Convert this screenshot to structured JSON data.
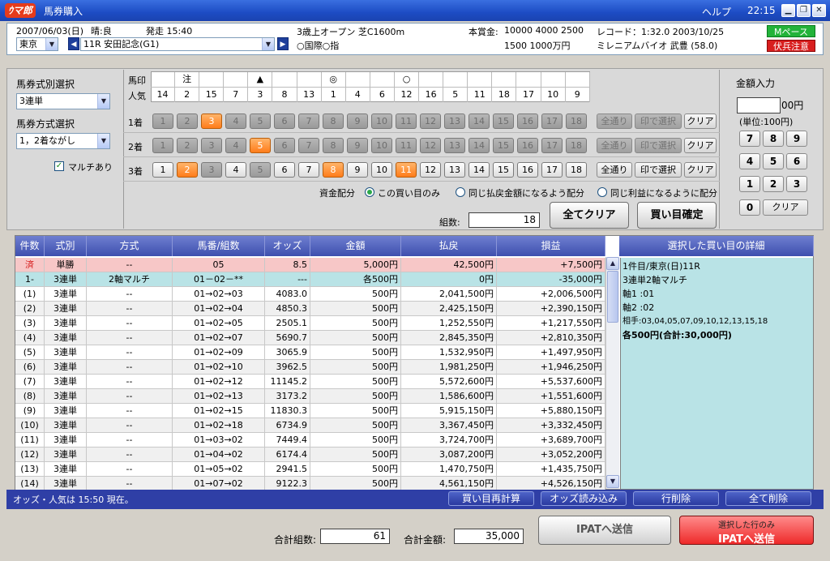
{
  "titlebar": {
    "logo": "ｳマ郎",
    "title": "馬券購入",
    "help": "ヘルプ",
    "clock": "22:15"
  },
  "race": {
    "date": "2007/06/03(日)",
    "track_cond": "晴:良",
    "post_time": "発走 15:40",
    "venue": "東京",
    "race": "11R 安田記念(G1)",
    "cond1": "3歳上オープン 芝C1600m",
    "cond2": "○国際○指",
    "prize_label": "本賞金:",
    "prize1": "10000 4000 2500",
    "prize2": "1500 1000万円",
    "record": "レコード：1:32.0 2003/10/25",
    "record_horse": "ミレニアムバイオ 武豊 (58.0)",
    "pace": "Mペース",
    "warning": "伏兵注意"
  },
  "left": {
    "type_label": "馬券式別選択",
    "type_value": "3連単",
    "method_label": "馬券方式選択",
    "method_value": "1，2着ながし",
    "multi_label": "マルチあり",
    "multi_checked": "✓"
  },
  "marks": {
    "row1_label": "馬印",
    "row2_label": "人気",
    "marks": [
      "",
      "注",
      "",
      "",
      "▲",
      "",
      "",
      "◎",
      "",
      "",
      "○",
      "",
      "",
      "",
      "",
      "",
      "",
      ""
    ],
    "popularity": [
      "14",
      "2",
      "15",
      "7",
      "3",
      "8",
      "13",
      "1",
      "4",
      "6",
      "12",
      "16",
      "5",
      "11",
      "18",
      "17",
      "10",
      "9"
    ]
  },
  "rows": [
    {
      "label": "1着",
      "state": [
        "d",
        "d",
        "o",
        "d",
        "d",
        "d",
        "d",
        "d",
        "d",
        "d",
        "d",
        "d",
        "d",
        "d",
        "d",
        "d",
        "d",
        "d"
      ]
    },
    {
      "label": "2着",
      "state": [
        "d",
        "d",
        "d",
        "d",
        "o",
        "d",
        "d",
        "d",
        "d",
        "d",
        "d",
        "d",
        "d",
        "d",
        "d",
        "d",
        "d",
        "d"
      ]
    },
    {
      "label": "3着",
      "state": [
        "n",
        "o",
        "d",
        "n",
        "d",
        "n",
        "n",
        "o",
        "n",
        "n",
        "o",
        "n",
        "n",
        "n",
        "n",
        "n",
        "n",
        "n"
      ]
    }
  ],
  "row_btns": [
    {
      "all": "全通り",
      "mark": "印で選択",
      "clear": "クリア"
    },
    {
      "all": "全通り",
      "mark": "印で選択",
      "clear": "クリア"
    },
    {
      "all": "全通り",
      "mark": "印で選択",
      "clear": "クリア"
    }
  ],
  "alloc": {
    "label": "資金配分",
    "opt1": "この買い目のみ",
    "opt2": "同じ払戻金額になるよう配分",
    "opt3": "同じ利益になるように配分"
  },
  "count": {
    "label": "組数:",
    "value": "18"
  },
  "buttons": {
    "clear_all": "全てクリア",
    "confirm": "買い目確定"
  },
  "amount": {
    "label": "金額入力",
    "unit": "00円",
    "unit_note": "(単位:100円)",
    "keys": [
      "7",
      "8",
      "9",
      "4",
      "5",
      "6",
      "1",
      "2",
      "3",
      "0"
    ],
    "clear": "クリア"
  },
  "table": {
    "headers": [
      "件数",
      "式別",
      "方式",
      "馬番/組数",
      "オッズ",
      "金額",
      "払戻",
      "損益"
    ],
    "detail_header": "選択した買い目の詳細",
    "rows": [
      [
        "済",
        "単勝",
        "--",
        "05",
        "8.5",
        "5,000円",
        "42,500円",
        "+7,500円"
      ],
      [
        "1-",
        "3連単",
        "2軸マルチ",
        "01－02－**",
        "---",
        "各500円",
        "0円",
        "-35,000円"
      ],
      [
        "(1)",
        "3連単",
        "--",
        "01→02→03",
        "4083.0",
        "500円",
        "2,041,500円",
        "+2,006,500円"
      ],
      [
        "(2)",
        "3連単",
        "--",
        "01→02→04",
        "4850.3",
        "500円",
        "2,425,150円",
        "+2,390,150円"
      ],
      [
        "(3)",
        "3連単",
        "--",
        "01→02→05",
        "2505.1",
        "500円",
        "1,252,550円",
        "+1,217,550円"
      ],
      [
        "(4)",
        "3連単",
        "--",
        "01→02→07",
        "5690.7",
        "500円",
        "2,845,350円",
        "+2,810,350円"
      ],
      [
        "(5)",
        "3連単",
        "--",
        "01→02→09",
        "3065.9",
        "500円",
        "1,532,950円",
        "+1,497,950円"
      ],
      [
        "(6)",
        "3連単",
        "--",
        "01→02→10",
        "3962.5",
        "500円",
        "1,981,250円",
        "+1,946,250円"
      ],
      [
        "(7)",
        "3連単",
        "--",
        "01→02→12",
        "11145.2",
        "500円",
        "5,572,600円",
        "+5,537,600円"
      ],
      [
        "(8)",
        "3連単",
        "--",
        "01→02→13",
        "3173.2",
        "500円",
        "1,586,600円",
        "+1,551,600円"
      ],
      [
        "(9)",
        "3連単",
        "--",
        "01→02→15",
        "11830.3",
        "500円",
        "5,915,150円",
        "+5,880,150円"
      ],
      [
        "(10)",
        "3連単",
        "--",
        "01→02→18",
        "6734.9",
        "500円",
        "3,367,450円",
        "+3,332,450円"
      ],
      [
        "(11)",
        "3連単",
        "--",
        "01→03→02",
        "7449.4",
        "500円",
        "3,724,700円",
        "+3,689,700円"
      ],
      [
        "(12)",
        "3連単",
        "--",
        "01→04→02",
        "6174.4",
        "500円",
        "3,087,200円",
        "+3,052,200円"
      ],
      [
        "(13)",
        "3連単",
        "--",
        "01→05→02",
        "2941.5",
        "500円",
        "1,470,750円",
        "+1,435,750円"
      ],
      [
        "(14)",
        "3連単",
        "--",
        "01→07→02",
        "9122.3",
        "500円",
        "4,561,150円",
        "+4,526,150円"
      ]
    ]
  },
  "detail": {
    "l1": "1件目/東京(日)11R",
    "l2": "3連単2軸マルチ",
    "l3": "軸1 :01",
    "l4": "軸2 :02",
    "l5": "相手:03,04,05,07,09,10,12,13,15,18",
    "l6": "各500円(合計:30,000円)"
  },
  "status": {
    "text": "オッズ・人気は 15:50 現在。",
    "recalc": "買い目再計算",
    "load_odds": "オッズ読み込み",
    "del_row": "行削除",
    "del_all": "全て削除"
  },
  "bottom": {
    "total_count_label": "合計組数:",
    "total_count": "61",
    "total_amount_label": "合計金額:",
    "total_amount": "35,000",
    "ipat": "IPATへ送信",
    "ipat_sel_small": "選択した行のみ",
    "ipat_sel": "IPATへ送信"
  }
}
